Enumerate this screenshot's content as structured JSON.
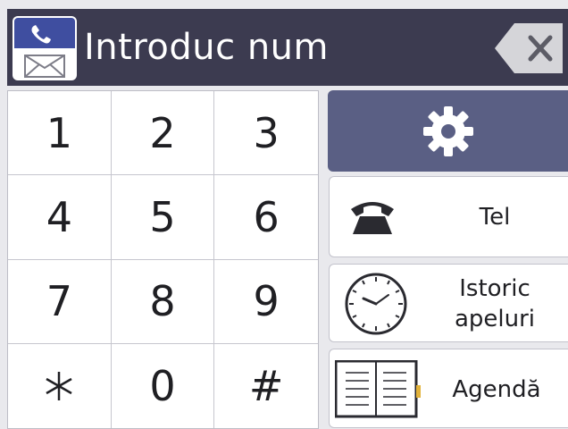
{
  "header": {
    "title": "Introduc num"
  },
  "keypad": {
    "keys": [
      "1",
      "2",
      "3",
      "4",
      "5",
      "6",
      "7",
      "8",
      "9",
      "*",
      "0",
      "#"
    ]
  },
  "buttons": {
    "tel_label": "Tel",
    "history_label_line1": "Istoric",
    "history_label_line2": "apeluri",
    "agenda_label": "Agendă"
  },
  "colors": {
    "header_bg": "#3c3b50",
    "settings_bg": "#5a5f84",
    "icon_blue": "#3f4ea0",
    "background": "#e9e9ed"
  },
  "icons": {
    "app": "phone-fax-icon",
    "backspace": "backspace-icon",
    "settings": "gear-icon",
    "tel": "telephone-icon",
    "history": "clock-icon",
    "agenda": "address-book-icon"
  }
}
